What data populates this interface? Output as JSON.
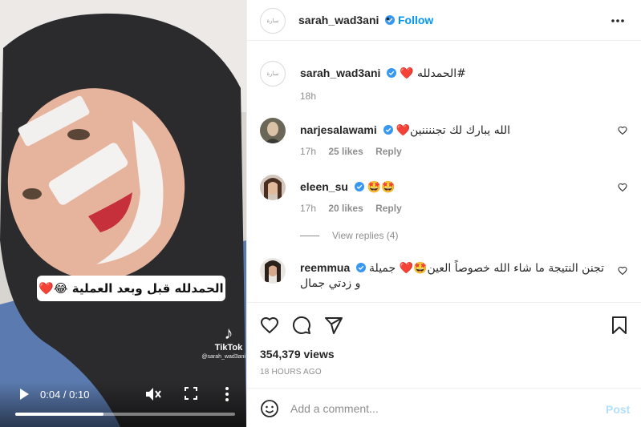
{
  "video": {
    "caption": "الحمدلله قبل وبعد العملية 😂❤️",
    "tiktok_label": "TikTok",
    "tiktok_handle": "@sarah_wad3ani",
    "time": "0:04 / 0:10",
    "progress": 0.4,
    "icons": [
      "play-icon",
      "mute-icon",
      "fullscreen-icon",
      "more-vertical-icon",
      "tiktok-icon"
    ]
  },
  "header": {
    "username": "sarah_wad3ani",
    "separator": "•",
    "follow_label": "Follow",
    "verified": true
  },
  "post": {
    "username": "sarah_wad3ani",
    "caption": "#الحمدلله ❤️",
    "age": "18h"
  },
  "comments": [
    {
      "username": "narjesalawami",
      "text": "الله يبارك لك تجننننين❤️",
      "age": "17h",
      "likes": "25 likes",
      "reply": "Reply"
    },
    {
      "username": "eleen_su",
      "text": "🤩🤩",
      "age": "17h",
      "likes": "20 likes",
      "reply": "Reply",
      "view_replies": "View replies (4)"
    },
    {
      "username": "reemmua",
      "text": "تجنن النتيجة ما شاء الله خصوصاً العين🤩❤️ جميلة و زدتي جمال"
    }
  ],
  "actions": {
    "views": "354,379 views",
    "posted": "18 HOURS AGO",
    "icons": [
      "heart-icon",
      "comment-icon",
      "share-icon",
      "bookmark-icon"
    ]
  },
  "add_comment": {
    "placeholder": "Add a comment...",
    "post_label": "Post"
  },
  "colors": {
    "accent": "#0095f6",
    "post_disabled": "#b2dffc",
    "heart": "#ed4956"
  }
}
